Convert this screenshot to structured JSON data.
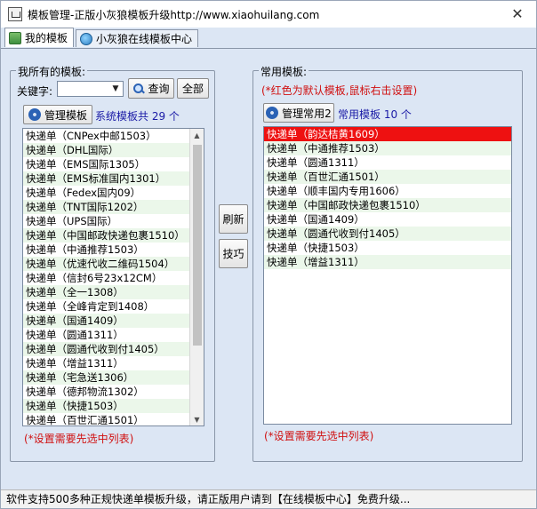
{
  "window": {
    "title": "模板管理-正版小灰狼模板升级http://www.xiaohuilang.com",
    "close": "✕"
  },
  "tabs": [
    {
      "label": "我的模板",
      "active": true
    },
    {
      "label": "小灰狼在线模板中心",
      "active": false
    }
  ],
  "left": {
    "group_title": "我所有的模板:",
    "keyword_label": "关键字:",
    "keyword_value": "",
    "query_button": "查询",
    "all_button": "全部",
    "manage_button": "管理模板",
    "count_text": "系统模板共 29 个",
    "items": [
      "快递单（CNPex中邮1503）",
      "快递单（DHL国际）",
      "快递单（EMS国际1305）",
      "快递单（EMS标准国内1301）",
      "快递单（Fedex国内09）",
      "快递单（TNT国际1202）",
      "快递单（UPS国际）",
      "快递单（中国邮政快递包裹1510）",
      "快递单（中通推荐1503）",
      "快递单（优速代收二维码1504）",
      "快递单（信封6号23x12CM）",
      "快递单（全一1308）",
      "快递单（全峰肯定到1408）",
      "快递单（国通1409）",
      "快递单（圆通1311）",
      "快递单（圆通代收到付1405）",
      "快递单（增益1311）",
      "快递单（宅急送1306）",
      "快递单（德邦物流1302）",
      "快递单（快捷1503）",
      "快递单（百世汇通1501）"
    ],
    "note": "(*设置需要先选中列表)"
  },
  "middle": {
    "refresh_button": "刷新",
    "tips_button": "技巧"
  },
  "right": {
    "group_title": "常用模板:",
    "hint": "(*红色为默认模板,鼠标右击设置)",
    "manage_button": "管理常用2",
    "count_text": "常用模板 10 个",
    "items": [
      "快递单（韵达桔黄1609）",
      "快递单（中通推荐1503）",
      "快递单（圆通1311）",
      "快递单（百世汇通1501）",
      "快递单（顺丰国内专用1606）",
      "快递单（中国邮政快递包裹1510）",
      "快递单（国通1409）",
      "快递单（圆通代收到付1405）",
      "快递单（快捷1503）",
      "快递单（增益1311）"
    ],
    "note": "(*设置需要先选中列表)"
  },
  "status": {
    "text": "软件支持500多种正规快递单模板升级，请正版用户请到【在线模板中心】免费升级..."
  },
  "colors": {
    "window_bg": "#dce6f4",
    "selected_row": "#ee1111",
    "alt_row": "#ebf7ea",
    "blue_text": "#1a1aa6",
    "red_text": "#d01010"
  }
}
